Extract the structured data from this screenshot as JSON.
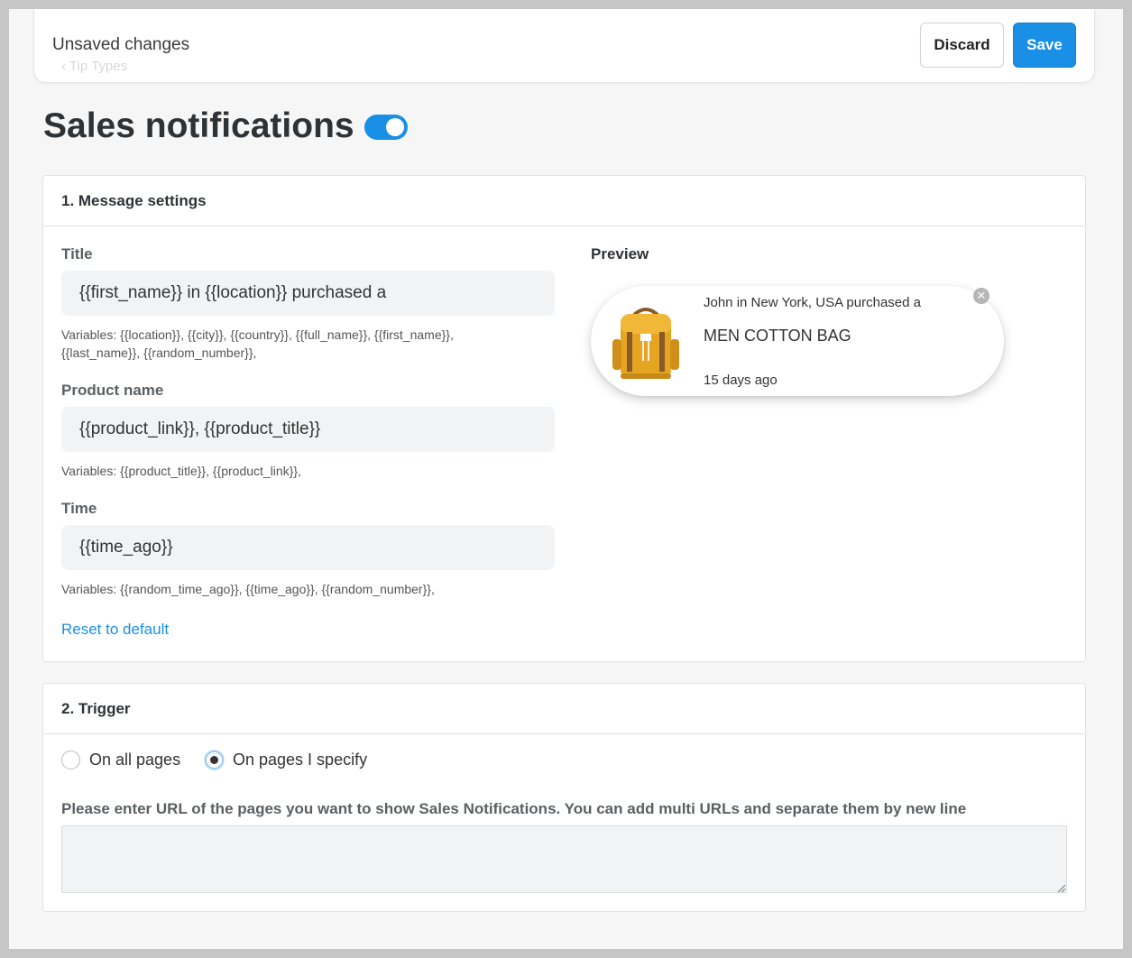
{
  "topbar": {
    "unsaved_text": "Unsaved changes",
    "back_text": "‹  Tip Types",
    "discard_label": "Discard",
    "save_label": "Save"
  },
  "page": {
    "title": "Sales notifications",
    "enabled": true
  },
  "message_settings": {
    "heading": "1. Message settings",
    "title_label": "Title",
    "title_value": "{{first_name}} in {{location}} purchased a",
    "title_hint": "Variables: {{location}}, {{city}}, {{country}}, {{full_name}}, {{first_name}}, {{last_name}}, {{random_number}},",
    "product_label": "Product name",
    "product_value": "{{product_link}}, {{product_title}}",
    "product_hint": "Variables: {{product_title}}, {{product_link}},",
    "time_label": "Time",
    "time_value": "{{time_ago}}",
    "time_hint": "Variables: {{random_time_ago}}, {{time_ago}}, {{random_number}},",
    "reset_label": "Reset to default"
  },
  "preview": {
    "label": "Preview",
    "line1": "John in New York, USA purchased a",
    "line2": "MEN COTTON BAG",
    "line3": "15 days ago",
    "close_glyph": "✕",
    "image_icon": "backpack-image"
  },
  "trigger": {
    "heading": "2. Trigger",
    "option_all": "On all pages",
    "option_specify": "On pages I specify",
    "selected": "option_specify",
    "url_label": "Please enter URL of the pages you want to show Sales Notifications. You can add multi URLs and separate them by new line",
    "url_value": ""
  },
  "colors": {
    "accent": "#1a8fe6",
    "page_bg": "#f6f6f7",
    "input_bg": "#f2f3f4"
  }
}
